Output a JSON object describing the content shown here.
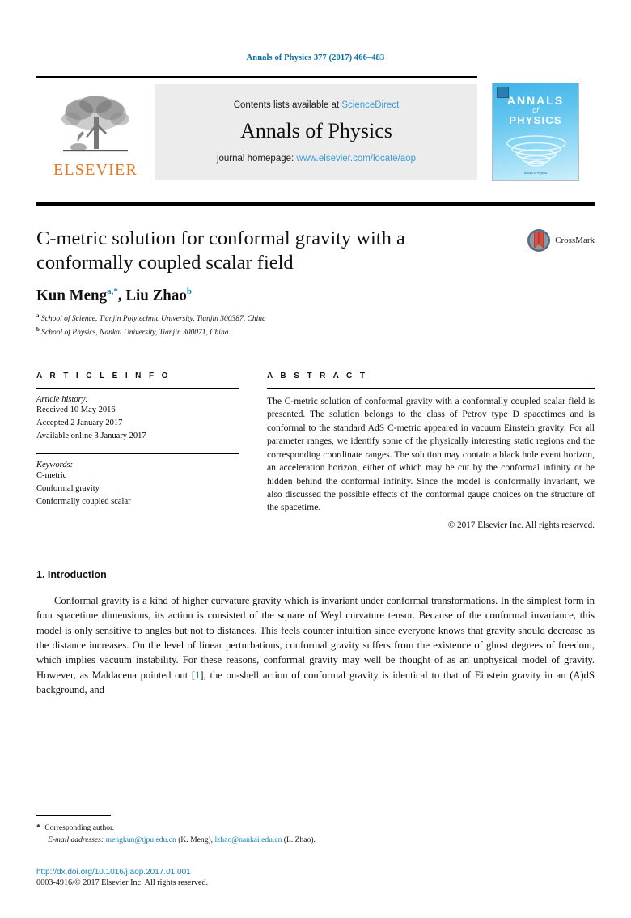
{
  "running_head": "Annals of Physics 377 (2017) 466–483",
  "masthead": {
    "publisher_logo_text": "ELSEVIER",
    "contents_prefix": "Contents lists available at",
    "contents_link": "ScienceDirect",
    "journal_name": "Annals of Physics",
    "homepage_prefix": "journal homepage:",
    "homepage_link": "www.elsevier.com/locate/aop",
    "cover": {
      "line1": "ANNALS",
      "line2": "of",
      "line3": "PHYSICS",
      "footer": "Annals of Physics"
    }
  },
  "article": {
    "title": "C-metric solution for conformal gravity with a conformally coupled scalar field",
    "authors": [
      {
        "name": "Kun Meng",
        "marks": "a,*"
      },
      {
        "name": "Liu Zhao",
        "marks": "b"
      }
    ],
    "affiliations": [
      {
        "mark": "a",
        "text": "School of Science, Tianjin Polytechnic University, Tianjin 300387, China"
      },
      {
        "mark": "b",
        "text": "School of Physics, Nankai University, Tianjin 300071, China"
      }
    ],
    "crossmark_label": "CrossMark"
  },
  "article_info": {
    "heading": "A R T I C L E   I N F O",
    "history_label": "Article history:",
    "history": [
      "Received 10 May 2016",
      "Accepted 2 January 2017",
      "Available online 3 January 2017"
    ],
    "keywords_label": "Keywords:",
    "keywords": [
      "C-metric",
      "Conformal gravity",
      "Conformally coupled scalar"
    ]
  },
  "abstract": {
    "heading": "A B S T R A C T",
    "text": "The C-metric solution of conformal gravity with a conformally coupled scalar field is presented. The solution belongs to the class of Petrov type D spacetimes and is conformal to the standard AdS C-metric appeared in vacuum Einstein gravity. For all parameter ranges, we identify some of the physically interesting static regions and the corresponding coordinate ranges. The solution may contain a black hole event horizon, an acceleration horizon, either of which may be cut by the conformal infinity or be hidden behind the conformal infinity. Since the model is conformally invariant, we also discussed the possible effects of the conformal gauge choices on the structure of the spacetime.",
    "copyright": "© 2017 Elsevier Inc. All rights reserved."
  },
  "body": {
    "section_heading": "1.  Introduction",
    "paragraph_part1": "Conformal gravity is a kind of higher curvature gravity which is invariant under conformal transformations. In the simplest form in four spacetime dimensions, its action is consisted of the square of Weyl curvature tensor. Because of the conformal invariance, this model is only sensitive to angles but not to distances. This feels counter intuition since everyone knows that gravity should decrease as the distance increases. On the level of linear perturbations, conformal gravity suffers from the existence of ghost degrees of freedom, which implies vacuum instability. For these reasons, conformal gravity may well be thought of as an unphysical model of gravity. However, as Maldacena pointed out [",
    "reference_number": "1",
    "paragraph_part2": "], the on-shell action of conformal gravity is identical to that of Einstein gravity in an (A)dS background, and"
  },
  "footnotes": {
    "corresponding_author": "Corresponding author.",
    "email_label": "E-mail addresses:",
    "email1": "mengkun@tjpu.edu.cn",
    "email1_name": "(K. Meng),",
    "email2": "lzhao@nankai.edu.cn",
    "email2_name": "(L. Zhao)."
  },
  "doi_block": {
    "doi_url": "http://dx.doi.org/10.1016/j.aop.2017.01.001",
    "issn_line": "0003-4916/© 2017 Elsevier Inc. All rights reserved."
  },
  "colors": {
    "link_blue": "#1581b8",
    "sciencedirect_blue": "#3c9cd6",
    "elsevier_orange": "#e87722",
    "runhead_blue": "#0a6ea0"
  }
}
